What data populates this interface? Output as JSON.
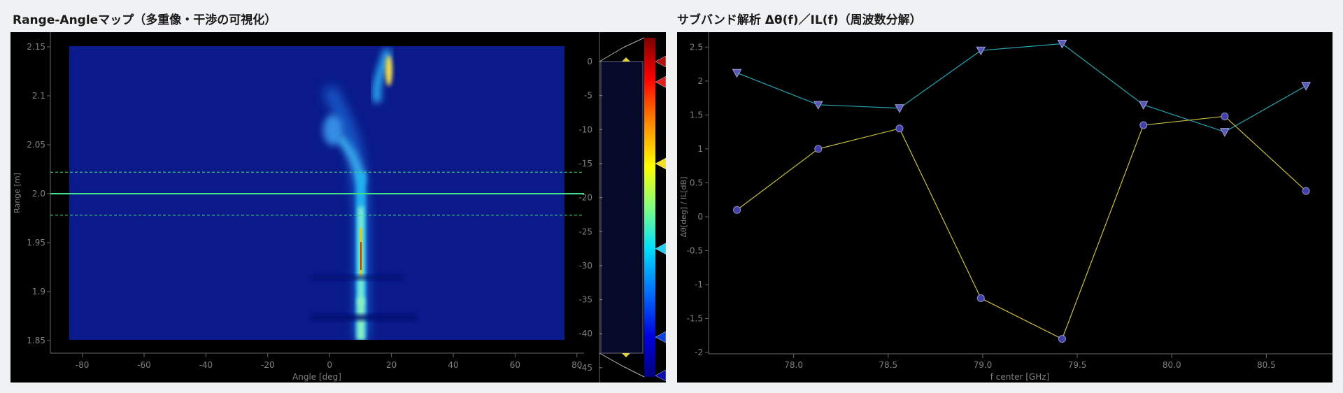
{
  "left_panel": {
    "title": "Range-Angleマップ（多重像・干渉の可視化）",
    "xlabel": "Angle [deg]",
    "ylabel": "Range [m]",
    "x_ticks": [
      "-80",
      "-60",
      "-40",
      "-20",
      "0",
      "20",
      "40",
      "60",
      "80"
    ],
    "y_ticks": [
      "2.15",
      "2.1",
      "2.05",
      "2.0",
      "1.95",
      "1.9",
      "1.85"
    ],
    "colorbar_ticks": [
      "0",
      "-5",
      "-10",
      "-15",
      "-20",
      "-25",
      "-30",
      "-35",
      "-40",
      "-45"
    ],
    "range_cursor": 2.0,
    "range_bounds": [
      1.978,
      2.022
    ],
    "colorbar_markers": [
      0,
      -3,
      -15,
      -27.5,
      -40.5,
      -48
    ]
  },
  "right_panel": {
    "title": "サブバンド解析 Δθ(f)／IL(f)（周波数分解）",
    "chart_data": {
      "type": "line",
      "xlabel": "f center [GHz]",
      "ylabel": "Δθ[deg] / IL[dB]",
      "x_ticks": [
        "78.0",
        "78.5",
        "79.0",
        "79.5",
        "80.0",
        "80.5"
      ],
      "y_ticks": [
        "2.5",
        "2",
        "1.5",
        "1",
        "0.5",
        "0",
        "-0.5",
        "-1",
        "-1.5",
        "-2"
      ],
      "xlim": [
        77.55,
        80.85
      ],
      "ylim": [
        -2.02,
        2.72
      ],
      "x": [
        77.7,
        78.13,
        78.56,
        78.99,
        79.42,
        79.85,
        80.28,
        80.71
      ],
      "series": [
        {
          "values": [
            2.12,
            1.65,
            1.6,
            2.45,
            2.55,
            1.65,
            1.25,
            1.93
          ],
          "marker": "triangle-down",
          "color": "#26a6b4"
        },
        {
          "values": [
            0.1,
            1.0,
            1.3,
            -1.2,
            -1.8,
            1.35,
            1.48,
            0.38
          ],
          "marker": "circle",
          "color": "#c8c040"
        }
      ]
    }
  }
}
